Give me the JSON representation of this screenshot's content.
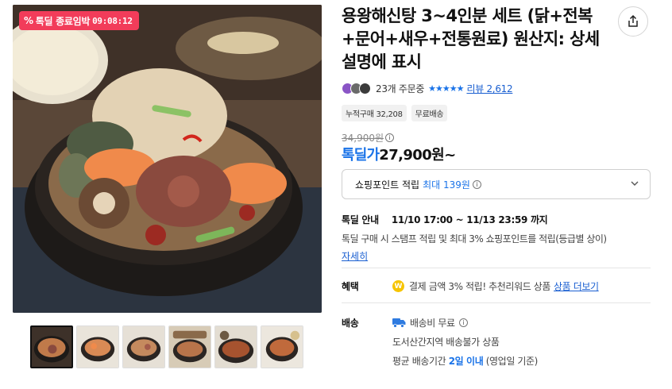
{
  "deal_badge": {
    "label": "톡딜 종료임박",
    "timer": "09:08:12",
    "icon": "percent-icon"
  },
  "product": {
    "title": "용왕해신탕 3~4인분 세트 (닭+전복+문어+새우+전통원료) 원산지: 상세설명에 표시"
  },
  "share": {
    "icon": "share-icon"
  },
  "rating": {
    "orders": "23개 주문중",
    "stars": "★★★★★",
    "review_link": "리뷰 2,612"
  },
  "tags": [
    "누적구매 32,208",
    "무료배송"
  ],
  "price": {
    "original": "34,900원",
    "sale_label": "톡딜가",
    "sale_value": "27,900원~"
  },
  "point": {
    "label": "쇼핑포인트 적립",
    "max": "최대 139원"
  },
  "deal_info": {
    "label": "톡딜 안내",
    "period": "11/10 17:00 ~ 11/13 23:59 까지",
    "desc": "톡딜 구매 시 스탬프 적립 및 최대 3% 쇼핑포인트를 적립(등급별 상이)",
    "more": "자세히"
  },
  "benefit": {
    "label": "혜택",
    "coin": "W",
    "text": "결제 금액 3% 적립! 추천리워드 상품",
    "link": "상품 더보기"
  },
  "shipping": {
    "label": "배송",
    "fee": "배송비 무료",
    "region": "도서산간지역 배송불가 상품",
    "avg_prefix": "평균 배송기간",
    "avg_days": "2일 이내",
    "avg_suffix": "(영업일 기준)",
    "icon": "truck-icon"
  },
  "thumbnails": [
    "thumb-1",
    "thumb-2",
    "thumb-3",
    "thumb-4",
    "thumb-5",
    "thumb-6"
  ],
  "colors": {
    "accent": "#1a73e8",
    "badge": "#f23c5a",
    "coin": "#f6c400"
  }
}
